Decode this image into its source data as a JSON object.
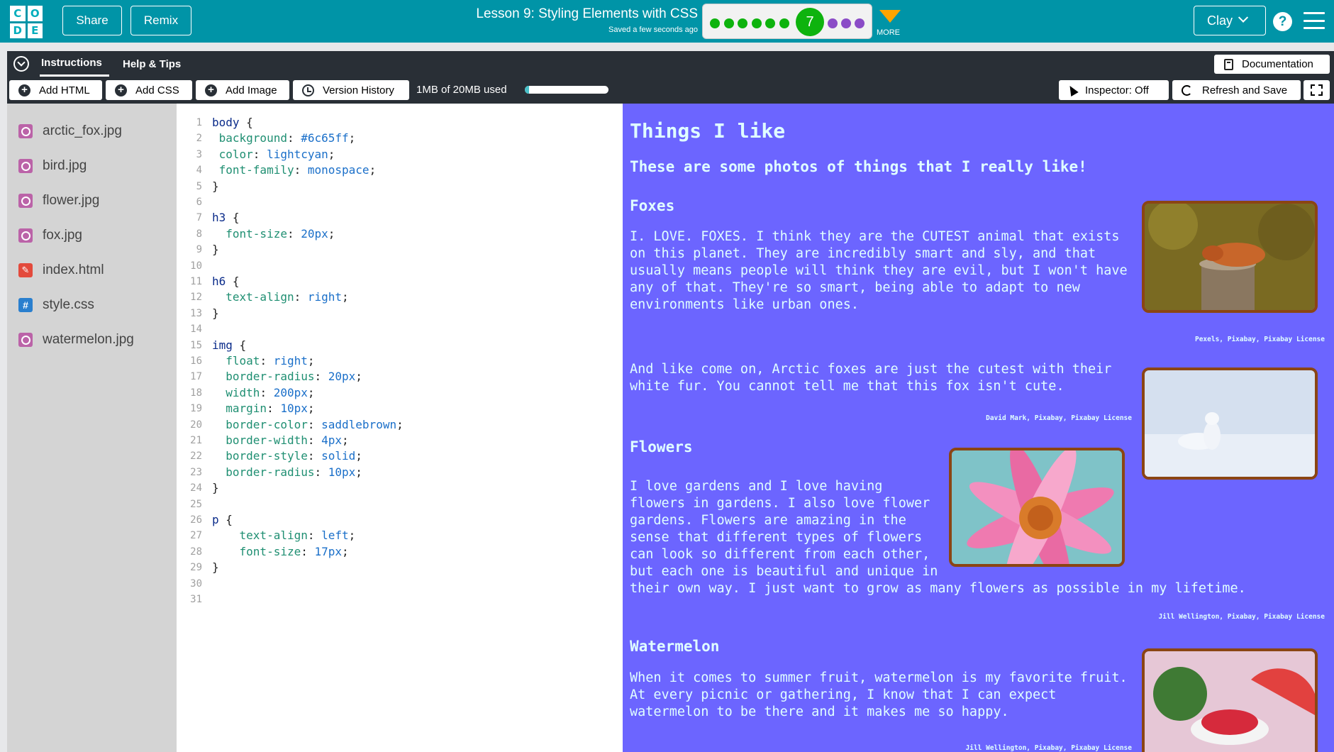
{
  "header": {
    "logo_letters": [
      "C",
      "O",
      "D",
      "E"
    ],
    "share_label": "Share",
    "remix_label": "Remix",
    "lesson_title": "Lesson 9: Styling Elements with CSS",
    "saved_text": "Saved a few seconds ago",
    "current_level": "7",
    "completed_levels": 6,
    "upcoming_levels": 3,
    "more_label": "MORE",
    "user_name": "Clay",
    "help_label": "?"
  },
  "instructions_bar": {
    "tabs": [
      "Instructions",
      "Help & Tips"
    ],
    "documentation_label": "Documentation"
  },
  "toolbar": {
    "add_html_label": "Add HTML",
    "add_css_label": "Add CSS",
    "add_image_label": "Add Image",
    "version_history_label": "Version History",
    "storage_text": "1MB of 20MB used",
    "storage_fraction": 0.05,
    "inspector_label": "Inspector: Off",
    "refresh_label": "Refresh and Save"
  },
  "files": [
    {
      "name": "arctic_fox.jpg",
      "type": "image"
    },
    {
      "name": "bird.jpg",
      "type": "image"
    },
    {
      "name": "flower.jpg",
      "type": "image"
    },
    {
      "name": "fox.jpg",
      "type": "image"
    },
    {
      "name": "index.html",
      "type": "html"
    },
    {
      "name": "style.css",
      "type": "css"
    },
    {
      "name": "watermelon.jpg",
      "type": "image"
    }
  ],
  "code_lines": [
    [
      [
        "sel",
        "body"
      ],
      [
        "punc",
        " {"
      ]
    ],
    [
      [
        "prop",
        " background"
      ],
      [
        "punc",
        ": "
      ],
      [
        "val",
        "#6c65ff"
      ],
      [
        "punc",
        ";"
      ]
    ],
    [
      [
        "prop",
        " color"
      ],
      [
        "punc",
        ": "
      ],
      [
        "val",
        "lightcyan"
      ],
      [
        "punc",
        ";"
      ]
    ],
    [
      [
        "prop",
        " font-family"
      ],
      [
        "punc",
        ": "
      ],
      [
        "val",
        "monospace"
      ],
      [
        "punc",
        ";"
      ]
    ],
    [
      [
        "punc",
        "}"
      ]
    ],
    [],
    [
      [
        "sel",
        "h3"
      ],
      [
        "punc",
        " {"
      ]
    ],
    [
      [
        "prop",
        "  font-size"
      ],
      [
        "punc",
        ": "
      ],
      [
        "val",
        "20px"
      ],
      [
        "punc",
        ";"
      ]
    ],
    [
      [
        "punc",
        "}"
      ]
    ],
    [],
    [
      [
        "sel",
        "h6"
      ],
      [
        "punc",
        " {"
      ]
    ],
    [
      [
        "prop",
        "  text-align"
      ],
      [
        "punc",
        ": "
      ],
      [
        "val",
        "right"
      ],
      [
        "punc",
        ";"
      ]
    ],
    [
      [
        "punc",
        "}"
      ]
    ],
    [],
    [
      [
        "sel",
        "img"
      ],
      [
        "punc",
        " {"
      ]
    ],
    [
      [
        "prop",
        "  float"
      ],
      [
        "punc",
        ": "
      ],
      [
        "val",
        "right"
      ],
      [
        "punc",
        ";"
      ]
    ],
    [
      [
        "prop",
        "  border-radius"
      ],
      [
        "punc",
        ": "
      ],
      [
        "val",
        "20px"
      ],
      [
        "punc",
        ";"
      ]
    ],
    [
      [
        "prop",
        "  width"
      ],
      [
        "punc",
        ": "
      ],
      [
        "val",
        "200px"
      ],
      [
        "punc",
        ";"
      ]
    ],
    [
      [
        "prop",
        "  margin"
      ],
      [
        "punc",
        ": "
      ],
      [
        "val",
        "10px"
      ],
      [
        "punc",
        ";"
      ]
    ],
    [
      [
        "prop",
        "  border-color"
      ],
      [
        "punc",
        ": "
      ],
      [
        "val",
        "saddlebrown"
      ],
      [
        "punc",
        ";"
      ]
    ],
    [
      [
        "prop",
        "  border-width"
      ],
      [
        "punc",
        ": "
      ],
      [
        "val",
        "4px"
      ],
      [
        "punc",
        ";"
      ]
    ],
    [
      [
        "prop",
        "  border-style"
      ],
      [
        "punc",
        ": "
      ],
      [
        "val",
        "solid"
      ],
      [
        "punc",
        ";"
      ]
    ],
    [
      [
        "prop",
        "  border-radius"
      ],
      [
        "punc",
        ": "
      ],
      [
        "val",
        "10px"
      ],
      [
        "punc",
        ";"
      ]
    ],
    [
      [
        "punc",
        "}"
      ]
    ],
    [],
    [
      [
        "sel",
        "p"
      ],
      [
        "punc",
        " {"
      ]
    ],
    [
      [
        "prop",
        "    text-align"
      ],
      [
        "punc",
        ": "
      ],
      [
        "val",
        "left"
      ],
      [
        "punc",
        ";"
      ]
    ],
    [
      [
        "prop",
        "    font-size"
      ],
      [
        "punc",
        ": "
      ],
      [
        "val",
        "17px"
      ],
      [
        "punc",
        ";"
      ]
    ],
    [
      [
        "punc",
        "}"
      ]
    ],
    [],
    []
  ],
  "preview": {
    "page_title": "Things I like",
    "intro": "These are some photos of things that I really like!",
    "foxes_heading": "Foxes",
    "foxes_p1": [
      "I. LOVE. FOXES. I think they are the CUTEST animal that exists",
      "on this planet. They are incredibly smart and sly, and that",
      "usually means people will think they are evil, but I won't have",
      "any of that. They're so smart, being able to adapt to new",
      "environments like urban ones."
    ],
    "fox_credit": "Pexels, Pixabay, Pixabay License",
    "foxes_p2": [
      "And like come on, Arctic foxes are just the cutest with their",
      "white fur. You cannot tell me that this fox isn't cute."
    ],
    "arctic_fox_credit": "David Mark, Pixabay, Pixabay License",
    "flowers_heading": "Flowers",
    "flowers_p": [
      "I love gardens and I love having",
      "flowers in gardens. I also love flower",
      "gardens. Flowers are amazing in the",
      "sense that different types of flowers",
      "can look so different from each other,",
      "but each one is beautiful and unique in",
      "their own way. I just want to grow as many flowers as possible in my lifetime."
    ],
    "flower_credit": "Jill Wellington, Pixabay, Pixabay License",
    "watermelon_heading": "Watermelon",
    "watermelon_p": [
      "When it comes to summer fruit, watermelon is my favorite fruit.",
      "At every picnic or gathering, I know that I can expect",
      "watermelon to be there and it makes me so happy."
    ],
    "watermelon_credit": "Jill Wellington, Pixabay, Pixabay License"
  },
  "colors": {
    "header_teal": "#0094a7",
    "progress_green": "#0eb30e",
    "progress_purple": "#8b4cc7",
    "more_orange": "#ffa400",
    "preview_background": "#6c65ff",
    "preview_text": "lightcyan",
    "image_border": "saddlebrown"
  }
}
